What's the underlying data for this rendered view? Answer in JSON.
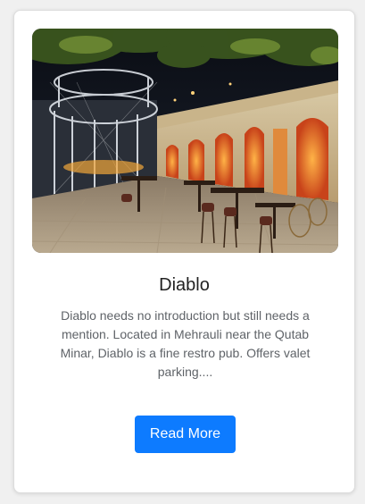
{
  "card": {
    "image_alt": "Diablo restaurant outdoor seating at night",
    "title": "Diablo",
    "description": "Diablo needs no introduction but still needs a mention. Located in Mehrauli near the Qutab Minar, Diablo is a fine restro pub. Offers valet parking....",
    "button_label": "Read More"
  },
  "colors": {
    "button_bg": "#0d7bff",
    "title_text": "#222222",
    "body_text": "#5f6368"
  }
}
